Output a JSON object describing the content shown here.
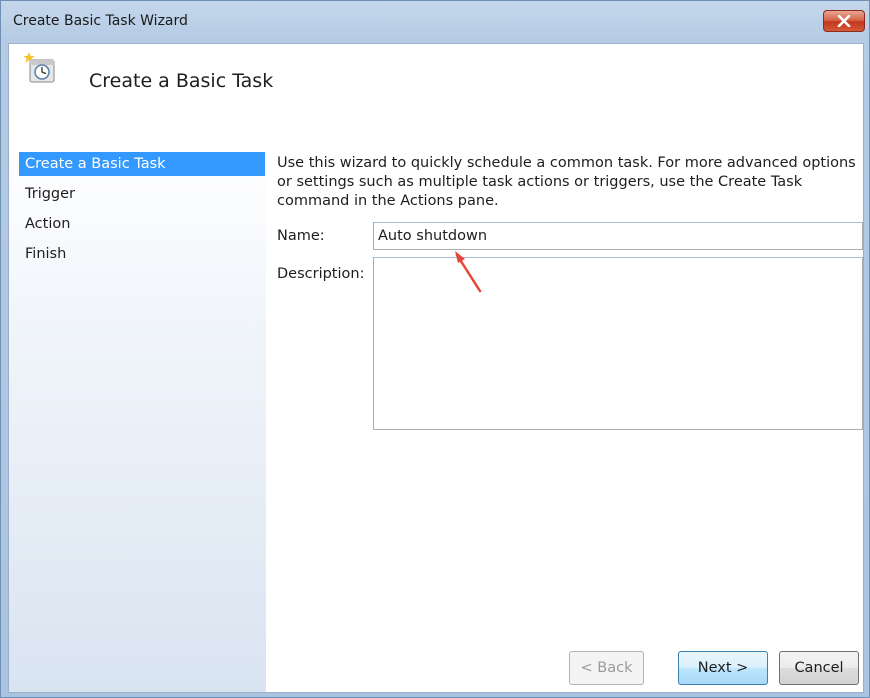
{
  "window": {
    "title": "Create Basic Task Wizard"
  },
  "header": {
    "title": "Create a Basic Task",
    "icon": "task-scheduler-clock-icon"
  },
  "nav": {
    "items": [
      {
        "label": "Create a Basic Task",
        "selected": true
      },
      {
        "label": "Trigger",
        "selected": false
      },
      {
        "label": "Action",
        "selected": false
      },
      {
        "label": "Finish",
        "selected": false
      }
    ]
  },
  "main": {
    "intro": "Use this wizard to quickly schedule a common task.  For more advanced options or settings such as multiple task actions or triggers, use the Create Task command in the Actions pane.",
    "name_label": "Name:",
    "name_value": "Auto shutdown",
    "description_label": "Description:",
    "description_value": ""
  },
  "buttons": {
    "back": "< Back",
    "next": "Next >",
    "cancel": "Cancel"
  },
  "colors": {
    "selection": "#3399ff",
    "annotation_arrow": "#e8463a",
    "close_button": "#c9452c"
  }
}
